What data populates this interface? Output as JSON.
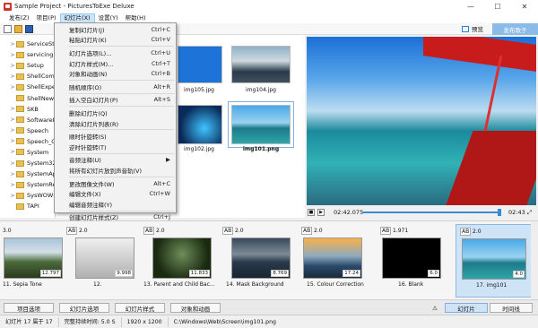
{
  "window": {
    "title": "Sample Project - PicturesToExe Deluxe",
    "controls": [
      "—",
      "☐",
      "✕"
    ]
  },
  "menubar": [
    "发布(Z)",
    "项目(P)",
    "幻灯片(X)",
    "设置(Y)",
    "帮助(H)"
  ],
  "toolbar": {
    "preview_label": "预览",
    "publish_label": "发布歌子"
  },
  "tree": [
    {
      "label": "ServiceSt",
      "arrow": ">"
    },
    {
      "label": "servicing",
      "arrow": ">"
    },
    {
      "label": "Setup",
      "arrow": ">"
    },
    {
      "label": "ShellCom",
      "arrow": ">"
    },
    {
      "label": "ShellExpe",
      "arrow": ">"
    },
    {
      "label": "ShellNew",
      "arrow": ""
    },
    {
      "label": "SKB",
      "arrow": ">"
    },
    {
      "label": "SoftwareD",
      "arrow": ">"
    },
    {
      "label": "Speech",
      "arrow": ">"
    },
    {
      "label": "Speech_O",
      "arrow": ">"
    },
    {
      "label": "System",
      "arrow": ">"
    },
    {
      "label": "System32",
      "arrow": ">"
    },
    {
      "label": "SystemAp",
      "arrow": ">"
    },
    {
      "label": "SystemRes",
      "arrow": ">"
    },
    {
      "label": "SysWOW6",
      "arrow": ">"
    },
    {
      "label": "TAPI",
      "arrow": ""
    }
  ],
  "slides": [
    {
      "name": "img105.jpg"
    },
    {
      "name": "img104.jpg"
    },
    {
      "name": "img102.jpg"
    },
    {
      "name": "img101.png"
    }
  ],
  "dropdown": {
    "groups": [
      [
        {
          "label": "复制幻灯片(J)",
          "shortcut": "Ctrl+C"
        },
        {
          "label": "粘贴幻灯片(K)",
          "shortcut": "Ctrl+V"
        }
      ],
      [
        {
          "label": "幻灯片选项(L)...",
          "shortcut": "Ctrl+U"
        },
        {
          "label": "幻灯片样式(M)...",
          "shortcut": "Ctrl+T"
        },
        {
          "label": "对象和动画(N)",
          "shortcut": "Ctrl+B"
        }
      ],
      [
        {
          "label": "随机顺序(O)",
          "shortcut": "Alt+R"
        }
      ],
      [
        {
          "label": "插入空白幻灯片(P)",
          "shortcut": "Alt+S"
        }
      ],
      [
        {
          "label": "删除幻灯片(Q)",
          "shortcut": ""
        },
        {
          "label": "清除幻灯片列表(R)",
          "shortcut": ""
        }
      ],
      [
        {
          "label": "顺时针旋转(S)",
          "shortcut": ""
        },
        {
          "label": "逆时针旋转(T)",
          "shortcut": ""
        }
      ],
      [
        {
          "label": "音频注释(U)",
          "shortcut": "▶"
        },
        {
          "label": "将所有幻灯片放到声音轨(V)",
          "shortcut": ""
        }
      ],
      [
        {
          "label": "更改图像文件(W)",
          "shortcut": "Alt+C"
        },
        {
          "label": "编辑文件(X)",
          "shortcut": "Ctrl+W"
        },
        {
          "label": "编辑音频注释(Y)",
          "shortcut": ""
        }
      ],
      [
        {
          "label": "创建幻灯片样式(Z)",
          "shortcut": "Ctrl+J"
        }
      ]
    ]
  },
  "player": {
    "current_time": "02:42.075",
    "end_time": "02:43",
    "progress": 0.99
  },
  "timeline": [
    {
      "ab": "",
      "duration": "3.0",
      "time": "12.797",
      "label": "11. Sepia Tone"
    },
    {
      "ab": "AB",
      "duration": "2.0",
      "time": "9.998",
      "label": "12."
    },
    {
      "ab": "AB",
      "duration": "2.0",
      "time": "11.833",
      "label": "13. Parent and Child Bac..."
    },
    {
      "ab": "AB",
      "duration": "2.0",
      "time": "8.769",
      "label": "14. Mask Background"
    },
    {
      "ab": "AB",
      "duration": "2.0",
      "time": "17.24",
      "label": "15. Colour Correction"
    },
    {
      "ab": "AB",
      "duration": "1.971",
      "time": "6.0",
      "label": "16. Blank"
    },
    {
      "ab": "AB",
      "duration": "2.0",
      "time": "4.0",
      "label": "17. img101"
    }
  ],
  "bottom_buttons": {
    "project_options": "项目选项",
    "slide_options": "幻灯片选项",
    "slide_style": "幻灯片样式",
    "objects_animation": "对象和动画",
    "warning": "⚠",
    "slides_tab": "幻灯片",
    "timeline_tab": "时间线"
  },
  "status": {
    "slide": "幻灯片 17 属于 17",
    "duration": "完整持续时间: 5.0 S",
    "size": "1920 x 1200",
    "path": "C:\\Windows\\Web\\Screen\\img101.png"
  }
}
